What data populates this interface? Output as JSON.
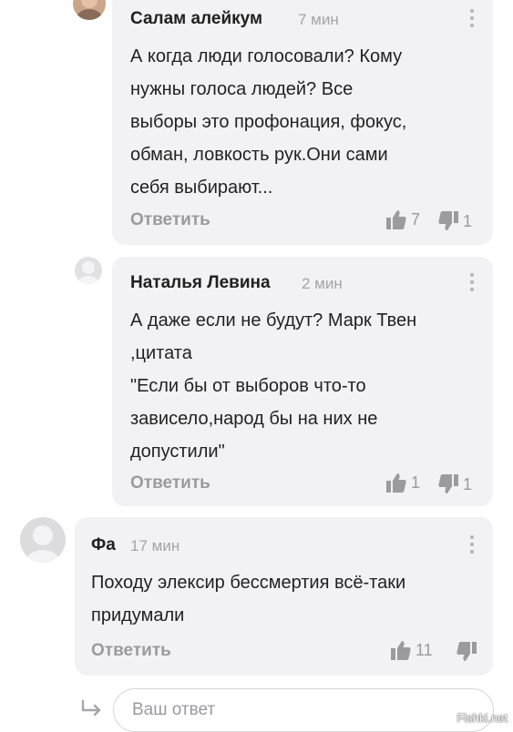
{
  "comments": [
    {
      "author": "Салам алейкум",
      "time": "7 мин",
      "text": "А когда люди голосовали? Кому\nнужны голоса людей? Все\nвыборы это профонация, фокус,\nобман, ловкость рук.Они сами\nсебя выбирают...",
      "reply_label": "Ответить",
      "likes": "7",
      "dislikes": "1"
    },
    {
      "author": "Наталья Левина",
      "time": "2 мин",
      "text": "А даже если не будут? Марк Твен\n,цитата\n\"Если бы от выборов что-то\nзависело,народ бы на них не\nдопустили\"",
      "reply_label": "Ответить",
      "likes": "1",
      "dislikes": "1"
    },
    {
      "author": "Фа",
      "time": "17 мин",
      "text": "Походу элексир бессмертия всё-таки\nпридумали",
      "reply_label": "Ответить",
      "likes": "11",
      "dislikes": ""
    }
  ],
  "reply_box": {
    "placeholder": "Ваш ответ"
  },
  "watermark": "Fishki.net",
  "icons": {
    "like": "thumbs-up-icon",
    "dislike": "thumbs-down-icon",
    "more": "more-vertical-icon",
    "reply": "reply-arrow-icon"
  },
  "colors": {
    "card_bg": "#f2f2f4",
    "muted": "#9b9b9f",
    "text": "#222222"
  }
}
